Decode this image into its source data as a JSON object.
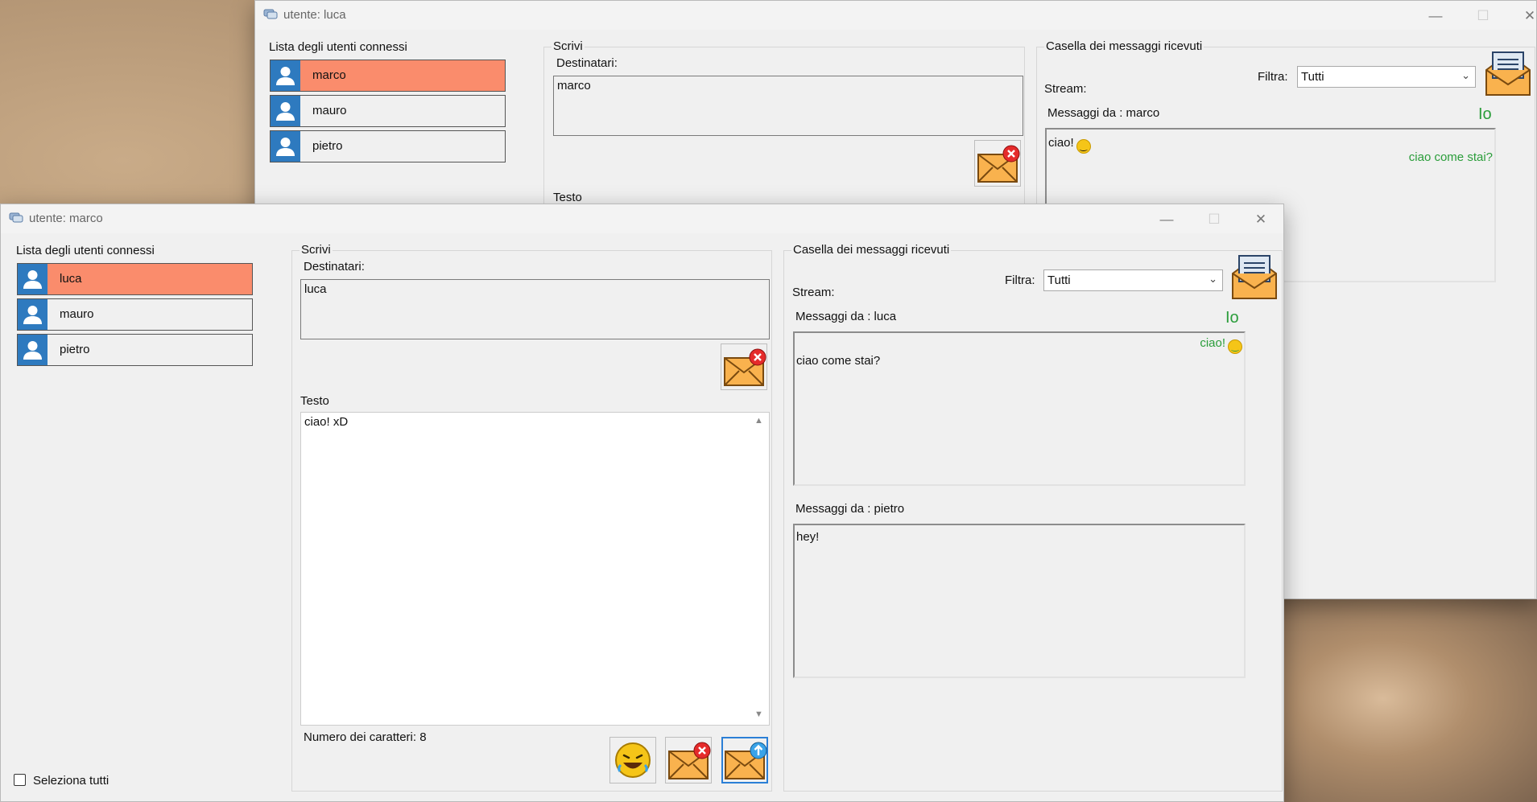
{
  "back_window": {
    "title": "utente: luca",
    "users_heading": "Lista degli utenti connessi",
    "users": [
      {
        "name": "marco",
        "selected": true
      },
      {
        "name": "mauro",
        "selected": false
      },
      {
        "name": "pietro",
        "selected": false
      }
    ],
    "write_group": "Scrivi",
    "recipients_label": "Destinatari:",
    "recipients_value": "marco",
    "text_label": "Testo",
    "inbox_group": "Casella dei messaggi ricevuti",
    "filter_label": "Filtra:",
    "filter_value": "Tutti",
    "stream_label": "Stream:",
    "conversations": [
      {
        "header": "Messaggi da : marco",
        "me_label": "Io",
        "received": "ciao!",
        "sent": "ciao come stai?"
      }
    ]
  },
  "front_window": {
    "title": "utente: marco",
    "users_heading": "Lista degli utenti connessi",
    "users": [
      {
        "name": "luca",
        "selected": true
      },
      {
        "name": "mauro",
        "selected": false
      },
      {
        "name": "pietro",
        "selected": false
      }
    ],
    "select_all_label": "Seleziona tutti",
    "write_group": "Scrivi",
    "recipients_label": "Destinatari:",
    "recipients_value": "luca",
    "text_label": "Testo",
    "text_value": "ciao! xD",
    "char_count_label": "Numero dei caratteri: 8",
    "inbox_group": "Casella dei messaggi ricevuti",
    "filter_label": "Filtra:",
    "filter_value": "Tutti",
    "stream_label": "Stream:",
    "conversations": [
      {
        "header": "Messaggi da : luca",
        "me_label": "Io",
        "sent": "ciao!",
        "received": "ciao come stai?"
      },
      {
        "header": "Messaggi da : pietro",
        "received": "hey!"
      }
    ]
  },
  "window_controls": {
    "minimize": "—",
    "maximize": "☐",
    "close": "✕"
  },
  "colors": {
    "selected_user": "#fa8c6c",
    "avatar": "#2e7abf",
    "own_message": "#2a9d3a",
    "envelope": "#f9b24e"
  },
  "icons": [
    "chat-app-icon",
    "user-avatar-icon",
    "clear-envelope-icon",
    "inbox-letter-icon",
    "emoji-icon",
    "send-envelope-icon",
    "chevron-down-icon"
  ]
}
